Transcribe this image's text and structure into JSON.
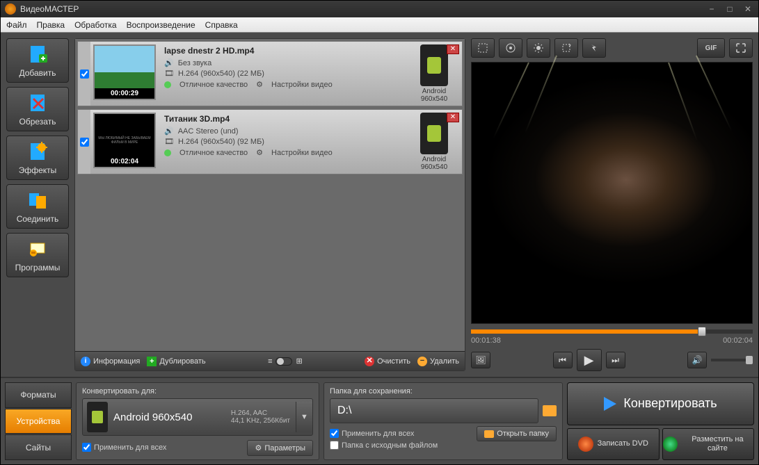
{
  "app": {
    "title": "ВидеоМАСТЕР"
  },
  "menu": [
    "Файл",
    "Правка",
    "Обработка",
    "Воспроизведение",
    "Справка"
  ],
  "sidebar": [
    {
      "label": "Добавить"
    },
    {
      "label": "Обрезать"
    },
    {
      "label": "Эффекты"
    },
    {
      "label": "Соединить"
    },
    {
      "label": "Программы"
    }
  ],
  "files": [
    {
      "name": "lapse dnestr 2 HD.mp4",
      "audio": "Без звука",
      "codec": "H.264 (960x540) (22 МБ)",
      "quality": "Отличное качество",
      "settings": "Настройки видео",
      "duration": "00:00:29",
      "device": "Android 960x540",
      "checked": true
    },
    {
      "name": "Титаник 3D.mp4",
      "audio": "AAC Stereo (und)",
      "codec": "H.264 (960x540) (92 МБ)",
      "quality": "Отличное качество",
      "settings": "Настройки видео",
      "duration": "00:02:04",
      "device": "Android 960x540",
      "checked": true
    }
  ],
  "listbar": {
    "info": "Информация",
    "dup": "Дублировать",
    "clear": "Очистить",
    "del": "Удалить"
  },
  "preview": {
    "time_cur": "00:01:38",
    "time_total": "00:02:04",
    "gif": "GIF"
  },
  "bottom": {
    "tabs": {
      "formats": "Форматы",
      "devices": "Устройства",
      "sites": "Сайты"
    },
    "conv": {
      "title": "Конвертировать для:",
      "device": "Android 960x540",
      "spec1": "H.264, AAC",
      "spec2": "44,1 KHz, 256Кбит",
      "apply": "Применить для всех",
      "params": "Параметры"
    },
    "save": {
      "title": "Папка для сохранения:",
      "path": "D:\\",
      "apply": "Применить для всех",
      "source": "Папка с исходным файлом",
      "open": "Открыть папку"
    },
    "convert": "Конвертировать",
    "dvd": "Записать DVD",
    "publish": "Разместить на сайте"
  }
}
